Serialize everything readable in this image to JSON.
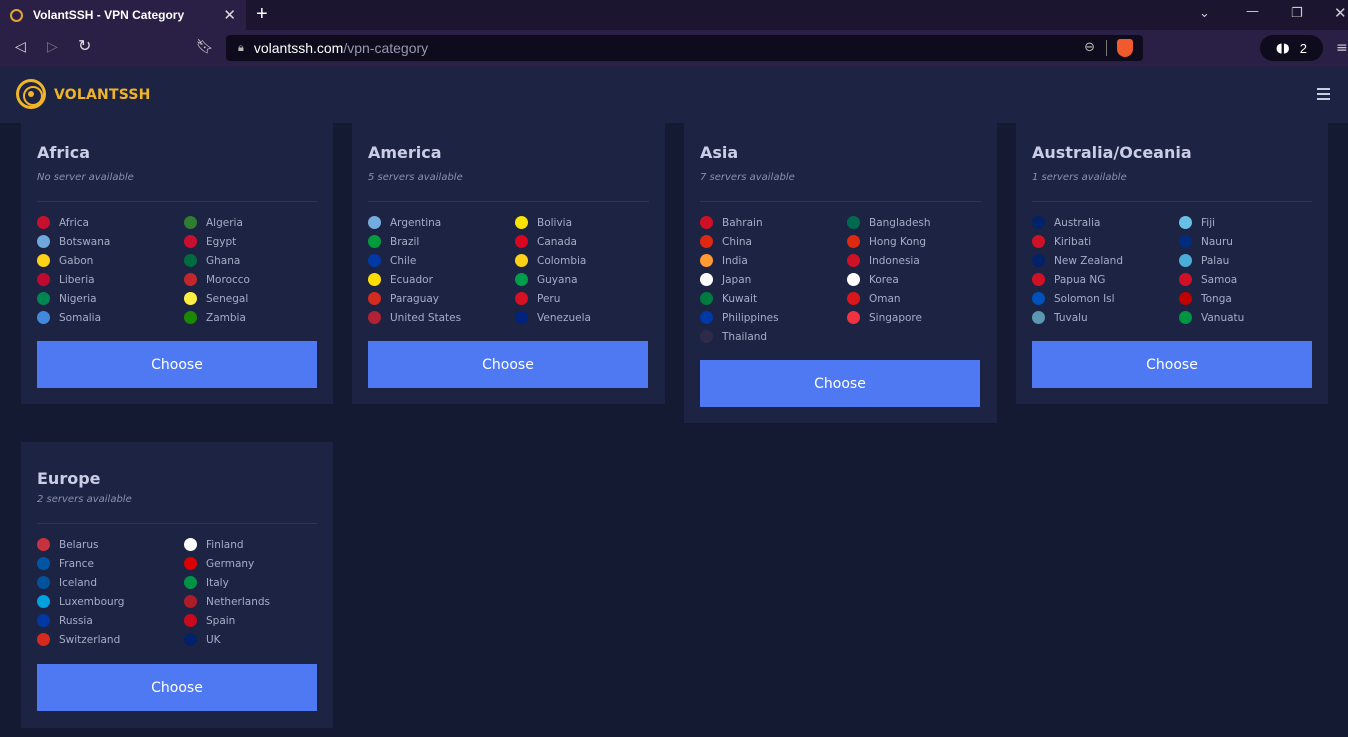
{
  "browser": {
    "tab_title": "VolantSSH - VPN Category",
    "tab_close": "✕",
    "new_tab": "+",
    "url_host": "volantssh.com",
    "url_path": "/vpn-category",
    "extension_count": "2",
    "icons": [
      "back-icon",
      "forward-icon",
      "reload-icon",
      "bookmark-icon",
      "lock-icon",
      "zoom-icon",
      "brave-shield-icon",
      "glasses-icon",
      "menu-icon"
    ]
  },
  "site": {
    "brand": "VOLANTSSH"
  },
  "regions": [
    {
      "title": "Africa",
      "subtitle": "No server available",
      "button": "Choose",
      "countries": [
        {
          "name": "Africa",
          "color": "#c8102e"
        },
        {
          "name": "Algeria",
          "color": "#2e7d32"
        },
        {
          "name": "Botswana",
          "color": "#6fa8dc"
        },
        {
          "name": "Egypt",
          "color": "#c8102e"
        },
        {
          "name": "Gabon",
          "color": "#fcd116"
        },
        {
          "name": "Ghana",
          "color": "#006b3f"
        },
        {
          "name": "Liberia",
          "color": "#bf0a30"
        },
        {
          "name": "Morocco",
          "color": "#c1272d"
        },
        {
          "name": "Nigeria",
          "color": "#008751"
        },
        {
          "name": "Senegal",
          "color": "#fdef42"
        },
        {
          "name": "Somalia",
          "color": "#4189dd"
        },
        {
          "name": "Zambia",
          "color": "#198a00"
        }
      ]
    },
    {
      "title": "America",
      "subtitle": "5 servers available",
      "button": "Choose",
      "countries": [
        {
          "name": "Argentina",
          "color": "#74acdf"
        },
        {
          "name": "Bolivia",
          "color": "#f9e300"
        },
        {
          "name": "Brazil",
          "color": "#009c3b"
        },
        {
          "name": "Canada",
          "color": "#d80621"
        },
        {
          "name": "Chile",
          "color": "#0039a6"
        },
        {
          "name": "Colombia",
          "color": "#fcd116"
        },
        {
          "name": "Ecuador",
          "color": "#ffdd00"
        },
        {
          "name": "Guyana",
          "color": "#009e49"
        },
        {
          "name": "Paraguay",
          "color": "#d52b1e"
        },
        {
          "name": "Peru",
          "color": "#d91023"
        },
        {
          "name": "United States",
          "color": "#b22234"
        },
        {
          "name": "Venezuela",
          "color": "#00247d"
        }
      ]
    },
    {
      "title": "Asia",
      "subtitle": "7 servers available",
      "button": "Choose",
      "countries": [
        {
          "name": "Bahrain",
          "color": "#ce1126"
        },
        {
          "name": "Bangladesh",
          "color": "#006a4e"
        },
        {
          "name": "China",
          "color": "#de2910"
        },
        {
          "name": "Hong Kong",
          "color": "#de2910"
        },
        {
          "name": "India",
          "color": "#ff9933"
        },
        {
          "name": "Indonesia",
          "color": "#ce1126"
        },
        {
          "name": "Japan",
          "color": "#ffffff"
        },
        {
          "name": "Korea",
          "color": "#ffffff"
        },
        {
          "name": "Kuwait",
          "color": "#007a3d"
        },
        {
          "name": "Oman",
          "color": "#db161b"
        },
        {
          "name": "Philippines",
          "color": "#0038a8"
        },
        {
          "name": "Singapore",
          "color": "#ef3340"
        },
        {
          "name": "Thailand",
          "color": "#2d2a4a"
        }
      ]
    },
    {
      "title": "Australia/Oceania",
      "subtitle": "1 servers available",
      "button": "Choose",
      "countries": [
        {
          "name": "Australia",
          "color": "#012169"
        },
        {
          "name": "Fiji",
          "color": "#68bfe5"
        },
        {
          "name": "Kiribati",
          "color": "#ce1126"
        },
        {
          "name": "Nauru",
          "color": "#002b7f"
        },
        {
          "name": "New Zealand",
          "color": "#012169"
        },
        {
          "name": "Palau",
          "color": "#4aadd6"
        },
        {
          "name": "Papua NG",
          "color": "#ce1126"
        },
        {
          "name": "Samoa",
          "color": "#ce1126"
        },
        {
          "name": "Solomon Isl",
          "color": "#0051ba"
        },
        {
          "name": "Tonga",
          "color": "#c10000"
        },
        {
          "name": "Tuvalu",
          "color": "#5b97b1"
        },
        {
          "name": "Vanuatu",
          "color": "#009543"
        }
      ]
    },
    {
      "title": "Europe",
      "subtitle": "2 servers available",
      "button": "Choose",
      "countries": [
        {
          "name": "Belarus",
          "color": "#c8313e"
        },
        {
          "name": "Finland",
          "color": "#ffffff"
        },
        {
          "name": "France",
          "color": "#0055a4"
        },
        {
          "name": "Germany",
          "color": "#dd0000"
        },
        {
          "name": "Iceland",
          "color": "#02529c"
        },
        {
          "name": "Italy",
          "color": "#009246"
        },
        {
          "name": "Luxembourg",
          "color": "#00a1de"
        },
        {
          "name": "Netherlands",
          "color": "#ae1c28"
        },
        {
          "name": "Russia",
          "color": "#0039a6"
        },
        {
          "name": "Spain",
          "color": "#c60b1e"
        },
        {
          "name": "Switzerland",
          "color": "#d52b1e"
        },
        {
          "name": "UK",
          "color": "#012169"
        }
      ]
    }
  ]
}
